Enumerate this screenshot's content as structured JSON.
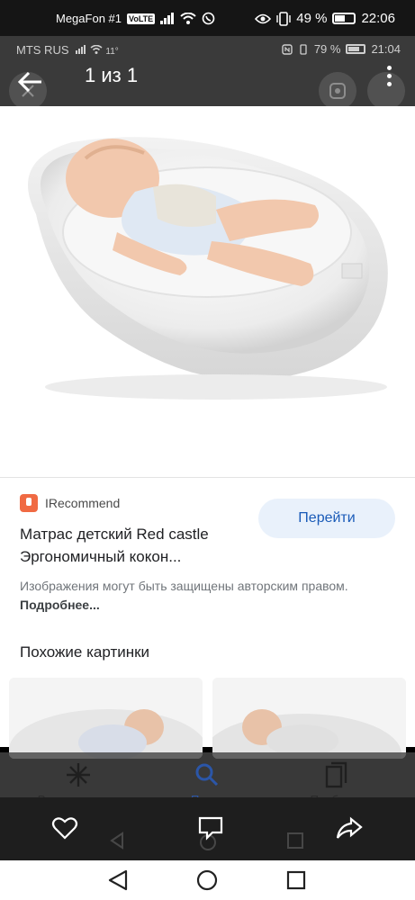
{
  "status_bar": {
    "carrier": "MegaFon #1",
    "volte": "VoLTE",
    "battery": "49 %",
    "time": "22:06"
  },
  "inner_status_bar": {
    "carrier": "MTS RUS",
    "temp": "11°",
    "battery": "79 %",
    "time": "21:04"
  },
  "viewer": {
    "counter": "1 из 1",
    "image_alt": "Baby sleeping in a white ergonomic cocoon mattress"
  },
  "result": {
    "source": "IRecommend",
    "title_line1": "Матрас детский Red castle",
    "title_line2": "Эргономичный кокон...",
    "go_button": "Перейти",
    "copyright": "Изображения могут быть защищены авторским правом.",
    "more": "Подробнее..."
  },
  "similar": {
    "title": "Похожие картинки"
  },
  "app_nav": {
    "items": [
      {
        "label": "Рекомендации"
      },
      {
        "label": "Поиск"
      },
      {
        "label": "Подборки"
      }
    ]
  },
  "colors": {
    "accent": "#1a5bb8",
    "button_bg": "#e9f1fb",
    "source_brand": "#f06a43"
  }
}
